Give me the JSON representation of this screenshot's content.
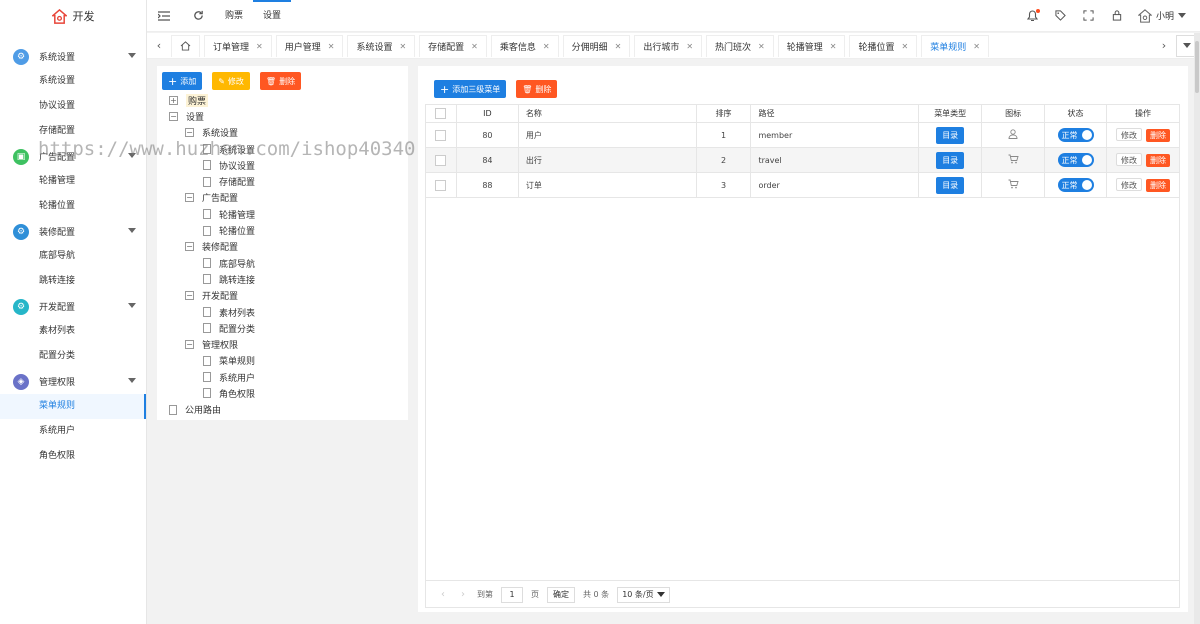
{
  "app": {
    "title": "开发"
  },
  "colors": {
    "accent": "#1e7fe1",
    "warn": "#ffb800",
    "danger": "#ff5722"
  },
  "sidebar": {
    "groups": [
      {
        "title": "系统设置",
        "icon": "gear-icon",
        "color": "#4f9ce6",
        "items": [
          "系统设置",
          "协议设置",
          "存储配置"
        ]
      },
      {
        "title": "广告配置",
        "icon": "image-icon",
        "color": "#3ec161",
        "items": [
          "轮播管理",
          "轮播位置"
        ]
      },
      {
        "title": "装修配置",
        "icon": "gear-icon",
        "color": "#2f8fd8",
        "items": [
          "底部导航",
          "跳转连接"
        ]
      },
      {
        "title": "开发配置",
        "icon": "gear-icon",
        "color": "#26b6c8",
        "items": [
          "素材列表",
          "配置分类"
        ]
      },
      {
        "title": "管理权限",
        "icon": "shield-icon",
        "color": "#6a72c8",
        "items": [
          "菜单规则",
          "系统用户",
          "角色权限"
        ]
      }
    ],
    "active_item": "菜单规则"
  },
  "header": {
    "nav": [
      "购票",
      "设置"
    ],
    "active_nav": "设置",
    "user": "小明"
  },
  "tabs": [
    "订单管理",
    "用户管理",
    "系统设置",
    "存储配置",
    "乘客信息",
    "分佣明细",
    "出行城市",
    "热门班次",
    "轮播管理",
    "轮播位置",
    "菜单规则"
  ],
  "active_tab": "菜单规则",
  "tree_panel": {
    "buttons": {
      "add": "添加",
      "edit": "修改",
      "delete": "删除"
    },
    "nodes": [
      {
        "label": "购票",
        "level": 0,
        "type": "plus",
        "selected": true
      },
      {
        "label": "设置",
        "level": 0,
        "type": "minus"
      },
      {
        "label": "系统设置",
        "level": 1,
        "type": "minus"
      },
      {
        "label": "系统设置",
        "level": 2,
        "type": "doc"
      },
      {
        "label": "协议设置",
        "level": 2,
        "type": "doc"
      },
      {
        "label": "存储配置",
        "level": 2,
        "type": "doc"
      },
      {
        "label": "广告配置",
        "level": 1,
        "type": "minus"
      },
      {
        "label": "轮播管理",
        "level": 2,
        "type": "doc"
      },
      {
        "label": "轮播位置",
        "level": 2,
        "type": "doc"
      },
      {
        "label": "装修配置",
        "level": 1,
        "type": "minus"
      },
      {
        "label": "底部导航",
        "level": 2,
        "type": "doc"
      },
      {
        "label": "跳转连接",
        "level": 2,
        "type": "doc"
      },
      {
        "label": "开发配置",
        "level": 1,
        "type": "minus"
      },
      {
        "label": "素材列表",
        "level": 2,
        "type": "doc"
      },
      {
        "label": "配置分类",
        "level": 2,
        "type": "doc"
      },
      {
        "label": "管理权限",
        "level": 1,
        "type": "minus"
      },
      {
        "label": "菜单规则",
        "level": 2,
        "type": "doc"
      },
      {
        "label": "系统用户",
        "level": 2,
        "type": "doc"
      },
      {
        "label": "角色权限",
        "level": 2,
        "type": "doc"
      },
      {
        "label": "公用路由",
        "level": 0,
        "type": "doc"
      }
    ]
  },
  "content": {
    "buttons": {
      "add_third": "添加三级菜单",
      "delete": "删除"
    },
    "columns": [
      "ID",
      "名称",
      "排序",
      "路径",
      "菜单类型",
      "图标",
      "状态",
      "操作"
    ],
    "rows": [
      {
        "id": "80",
        "name": "用户",
        "sort": "1",
        "path": "member",
        "type": "目录",
        "icon": "user-icon",
        "status": "正常"
      },
      {
        "id": "84",
        "name": "出行",
        "sort": "2",
        "path": "travel",
        "type": "目录",
        "icon": "cart-icon",
        "status": "正常"
      },
      {
        "id": "88",
        "name": "订单",
        "sort": "3",
        "path": "order",
        "type": "目录",
        "icon": "cart-icon",
        "status": "正常"
      }
    ],
    "row_actions": {
      "edit": "修改",
      "delete": "删除"
    },
    "pager": {
      "goto": "到第",
      "page": "1",
      "page_unit": "页",
      "confirm": "确定",
      "total": "共 0 条",
      "per_page": "10 条/页"
    }
  },
  "watermark": "https://www.huzhan.com/ishop40340"
}
